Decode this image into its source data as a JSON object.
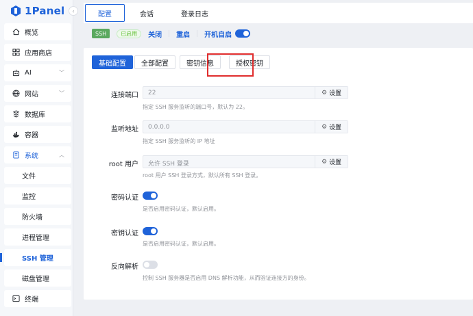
{
  "app": {
    "logo_text": "1Panel"
  },
  "sidebar": {
    "items": [
      {
        "label": "概览",
        "icon": "home-icon"
      },
      {
        "label": "应用商店",
        "icon": "apps-icon"
      },
      {
        "label": "AI",
        "icon": "robot-icon"
      },
      {
        "label": "网站",
        "icon": "globe-icon"
      },
      {
        "label": "数据库",
        "icon": "database-icon"
      },
      {
        "label": "容器",
        "icon": "container-icon"
      },
      {
        "label": "系统",
        "icon": "system-icon"
      }
    ],
    "sub_items": [
      {
        "label": "文件"
      },
      {
        "label": "监控"
      },
      {
        "label": "防火墙"
      },
      {
        "label": "进程管理"
      },
      {
        "label": "SSH 管理"
      },
      {
        "label": "磁盘管理"
      }
    ],
    "terminal": {
      "label": "终端",
      "icon": "terminal-icon"
    }
  },
  "tabs": [
    {
      "label": "配置"
    },
    {
      "label": "会话"
    },
    {
      "label": "登录日志"
    }
  ],
  "status": {
    "service": "SSH",
    "state": "已启用",
    "close": "关闭",
    "restart": "重启",
    "autostart": "开机自启"
  },
  "subtabs": [
    {
      "label": "基础配置"
    },
    {
      "label": "全部配置"
    },
    {
      "label": "密钥信息"
    },
    {
      "label": "授权密钥"
    }
  ],
  "form": {
    "port": {
      "label": "连接端口",
      "value": "22",
      "button": "设置",
      "hint": "指定 SSH 服务监听的端口号，默认为 22。"
    },
    "listen": {
      "label": "监听地址",
      "value": "0.0.0.0",
      "button": "设置",
      "hint": "指定 SSH 服务监听的 IP 地址"
    },
    "root": {
      "label": "root 用户",
      "value": "允许 SSH 登录",
      "button": "设置",
      "hint": "root 用户 SSH 登录方式，默认所有 SSH 登录。"
    },
    "password_auth": {
      "label": "密码认证",
      "hint": "是否启用密码认证，默认启用。",
      "enabled": true
    },
    "key_auth": {
      "label": "密钥认证",
      "hint": "是否启用密码认证，默认启用。",
      "enabled": true
    },
    "reverse_dns": {
      "label": "反向解析",
      "hint": "控制 SSH 服务器是否启用 DNS 解析功能，从而验证连接方的身份。",
      "enabled": false
    }
  }
}
